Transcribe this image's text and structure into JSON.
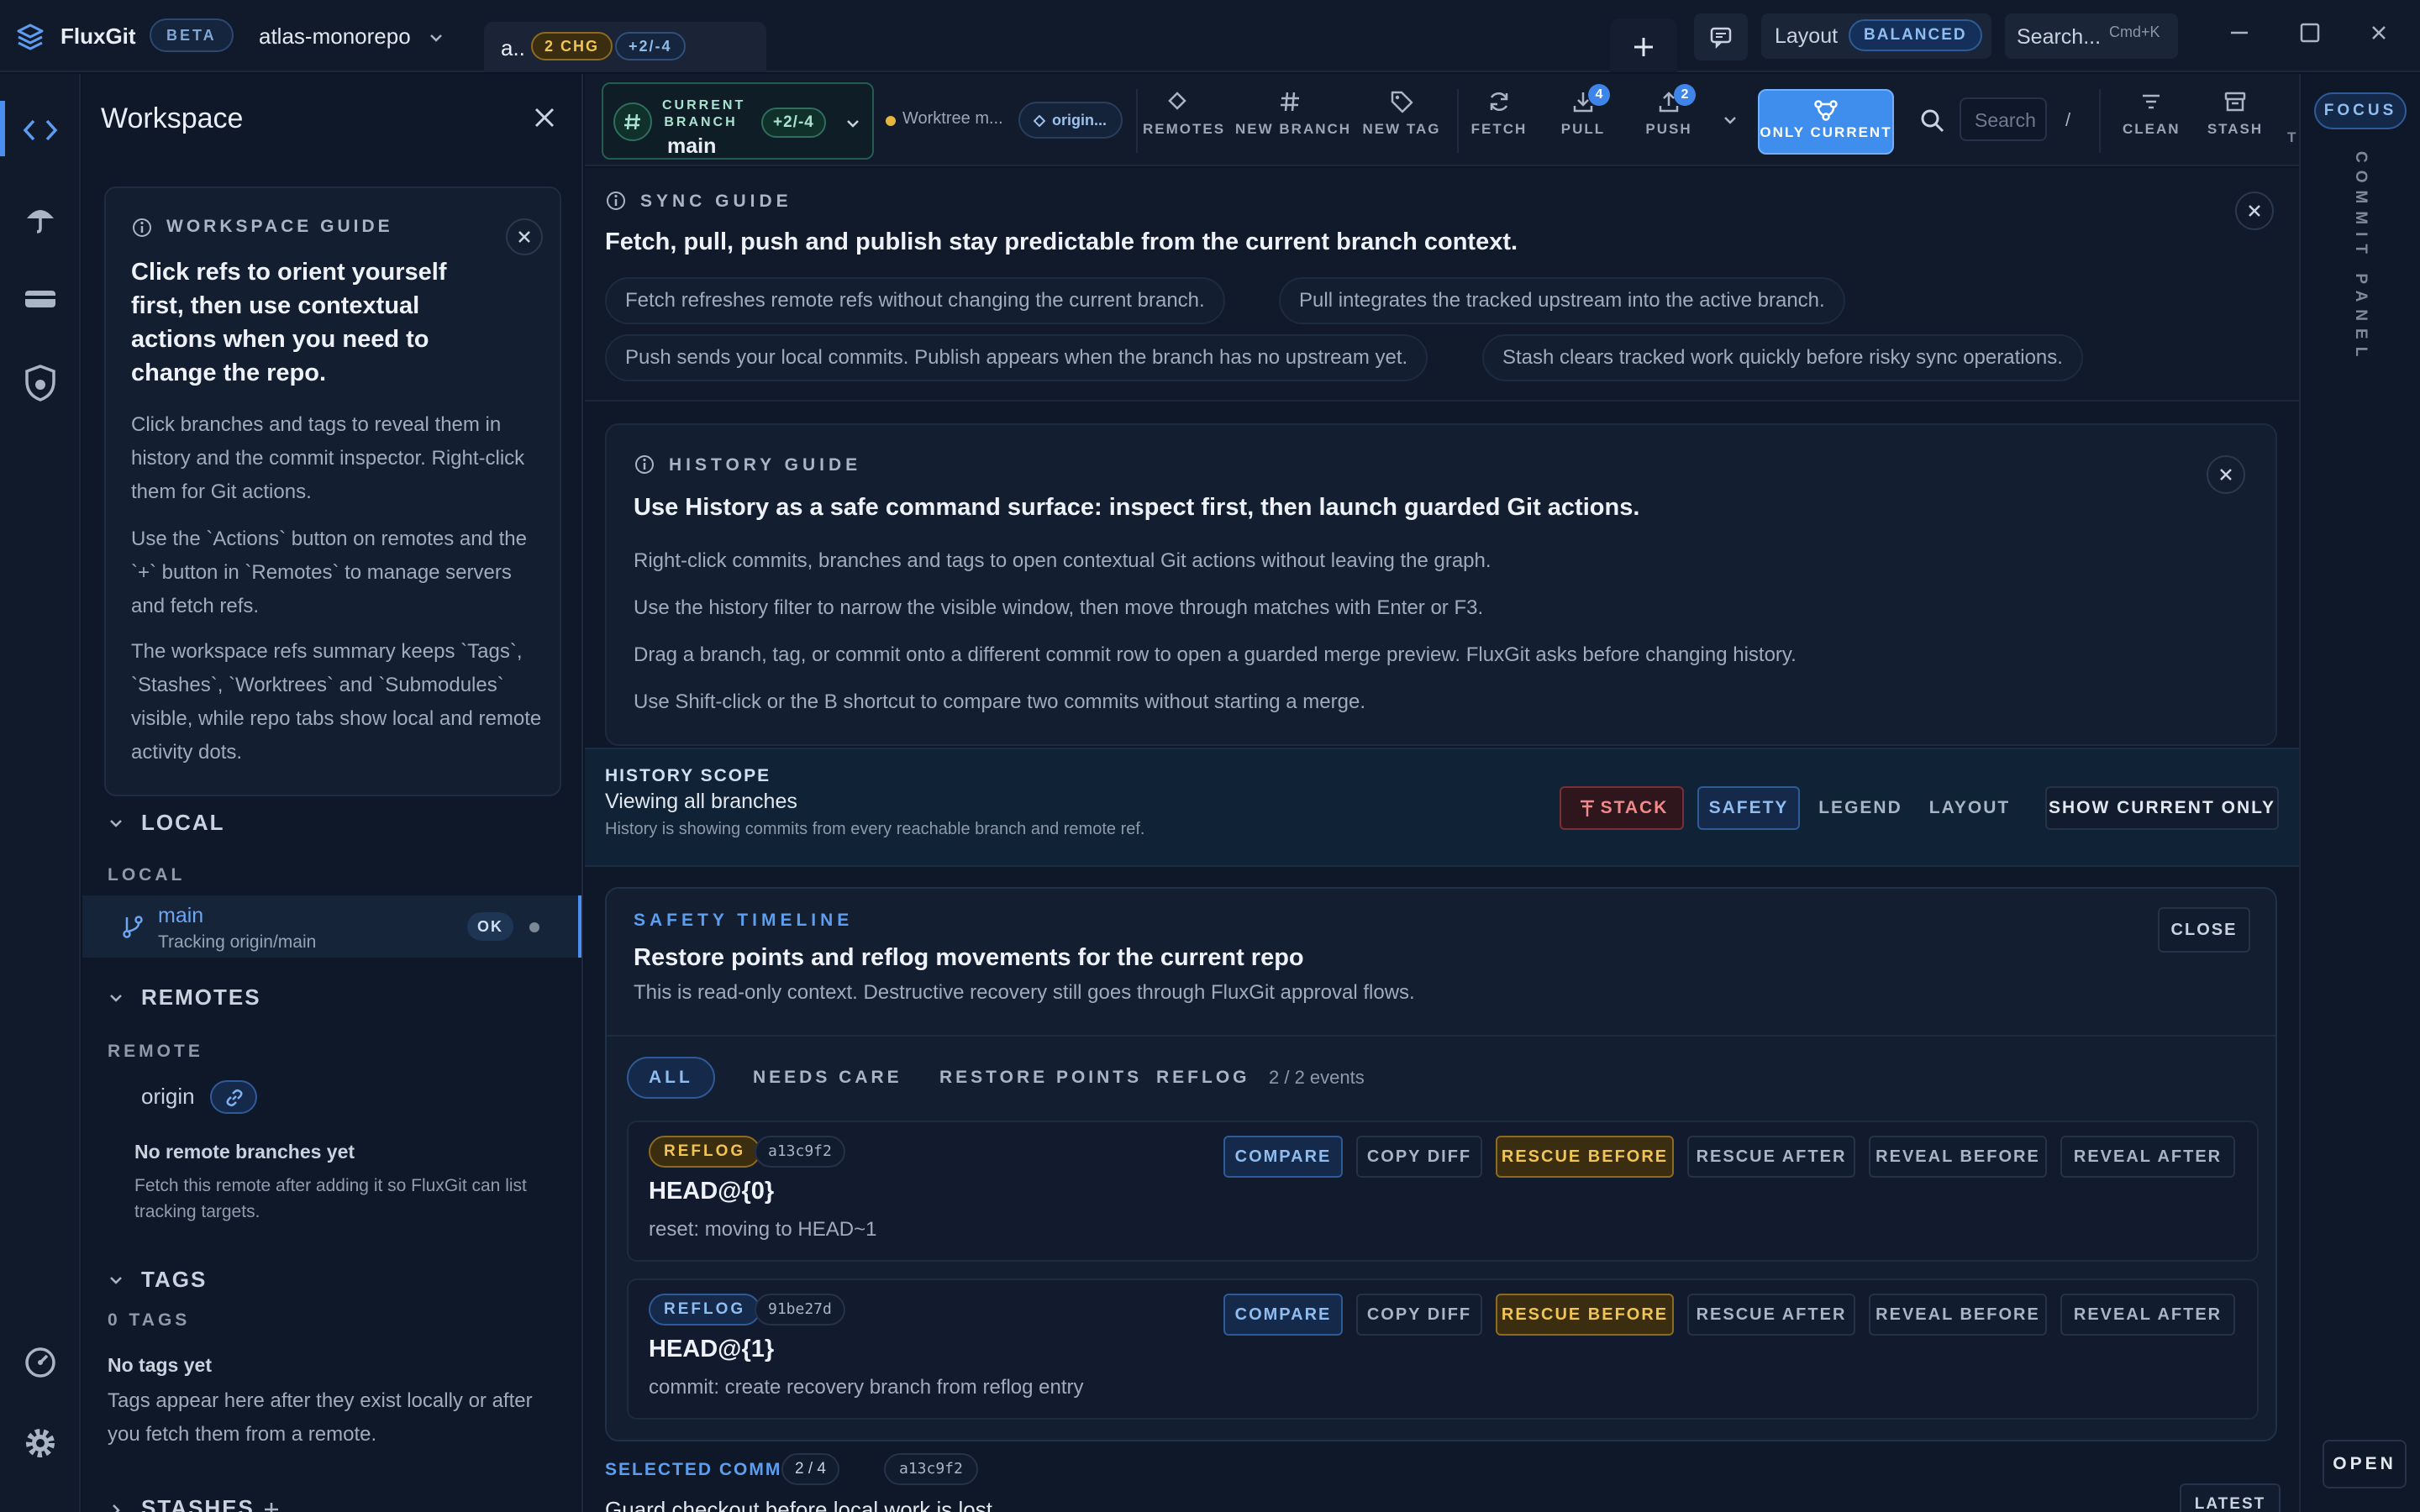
{
  "app": {
    "name": "FluxGit",
    "beta": "BETA",
    "repo": "atlas-monorepo"
  },
  "tab": {
    "label": "a..",
    "changes": "2 CHG",
    "diff": "+2/-4"
  },
  "titlebar": {
    "layout_label": "Layout",
    "layout_value": "BALANCED",
    "search": "Search...",
    "search_kbd": "Cmd+K"
  },
  "sidebar": {
    "title": "Workspace",
    "guide": {
      "heading": "WORKSPACE GUIDE",
      "title": "Click refs to orient yourself first, then use contextual actions when you need to change the repo.",
      "p1": "Click branches and tags to reveal them in history and the commit inspector. Right-click them for Git actions.",
      "p2": "Use the `Actions` button on remotes and the `+` button in `Remotes` to manage servers and fetch refs.",
      "p3": "The workspace refs summary keeps `Tags`, `Stashes`, `Worktrees` and `Submodules` visible, while repo tabs show local and remote activity dots."
    },
    "local": {
      "section": "LOCAL",
      "sub": "LOCAL",
      "branch": "main",
      "tracking": "Tracking origin/main",
      "status": "OK"
    },
    "remotes": {
      "section": "REMOTES",
      "sub": "REMOTE",
      "name": "origin",
      "empty_title": "No remote branches yet",
      "empty_text": "Fetch this remote after adding it so FluxGit can list tracking targets."
    },
    "tags": {
      "section": "TAGS",
      "count": "0 TAGS",
      "empty_title": "No tags yet",
      "empty_text": "Tags appear here after they exist locally or after you fetch them from a remote."
    },
    "stashes": {
      "section": "STASHES"
    }
  },
  "toolbar": {
    "current_branch_label": "CURRENT BRANCH",
    "current_branch": "main",
    "branch_diff": "+2/-4",
    "worktree": "Worktree m...",
    "origin": "origin...",
    "remotes": "REMOTES",
    "new_branch": "NEW BRANCH",
    "new_tag": "NEW TAG",
    "fetch": "FETCH",
    "pull": "PULL",
    "pull_count": "4",
    "push": "PUSH",
    "push_count": "2",
    "only_current": "ONLY CURRENT",
    "search_placeholder": "Search",
    "slash": "/",
    "clean": "CLEAN",
    "stash": "STASH",
    "more": "T"
  },
  "rightrail": {
    "focus": "FOCUS",
    "panel": "COMMIT PANEL",
    "open": "OPEN"
  },
  "sync_guide": {
    "heading": "SYNC GUIDE",
    "title": "Fetch, pull, push and publish stay predictable from the current branch context.",
    "pills": [
      "Fetch refreshes remote refs without changing the current branch.",
      "Pull integrates the tracked upstream into the active branch.",
      "Push sends your local commits. Publish appears when the branch has no upstream yet.",
      "Stash clears tracked work quickly before risky sync operations."
    ]
  },
  "history_guide": {
    "heading": "HISTORY GUIDE",
    "title": "Use History as a safe command surface: inspect first, then launch guarded Git actions.",
    "lines": [
      "Right-click commits, branches and tags to open contextual Git actions without leaving the graph.",
      "Use the history filter to narrow the visible window, then move through matches with Enter or F3.",
      "Drag a branch, tag, or commit onto a different commit row to open a guarded merge preview. FluxGit asks before changing history.",
      "Use Shift-click or the B shortcut to compare two commits without starting a merge."
    ]
  },
  "scope": {
    "heading": "HISTORY SCOPE",
    "value": "Viewing all branches",
    "sub": "History is showing commits from every reachable branch and remote ref.",
    "stack": "STACK",
    "safety": "SAFETY",
    "legend": "LEGEND",
    "layout": "LAYOUT",
    "show_current": "SHOW CURRENT ONLY"
  },
  "safety": {
    "heading": "SAFETY TIMELINE",
    "title": "Restore points and reflog movements for the current repo",
    "sub": "This is read-only context. Destructive recovery still goes through FluxGit approval flows.",
    "close": "CLOSE",
    "filters": [
      "ALL",
      "NEEDS CARE",
      "RESTORE POINTS",
      "REFLOG"
    ],
    "count": "2 / 2 events",
    "events": [
      {
        "tag": "REFLOG",
        "hash": "a13c9f2",
        "title": "HEAD@{0}",
        "sub": "reset: moving to HEAD~1"
      },
      {
        "tag": "REFLOG",
        "hash": "91be27d",
        "title": "HEAD@{1}",
        "sub": "commit: create recovery branch from reflog entry"
      }
    ],
    "actions": {
      "compare": "COMPARE",
      "copy_diff": "COPY DIFF",
      "rescue_before": "RESCUE BEFORE",
      "rescue_after": "RESCUE AFTER",
      "reveal_before": "REVEAL BEFORE",
      "reveal_after": "REVEAL AFTER"
    }
  },
  "selected": {
    "heading": "SELECTED COMMIT",
    "count": "2 / 4",
    "hash": "a13c9f2",
    "title": "Guard checkout before local work is lost",
    "latest": "LATEST"
  }
}
